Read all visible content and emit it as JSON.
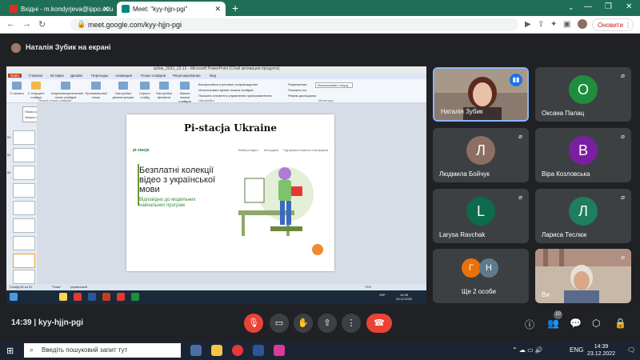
{
  "browser": {
    "tabs": [
      {
        "title": "Вхідні - m.kondyrjeva@ippo.edu"
      },
      {
        "title": "Meet: \"kyy-hjjn-pgi\""
      }
    ],
    "url": "meet.google.com/kyy-hjjn-pgi",
    "update_label": "Оновити"
  },
  "meet": {
    "presenting_label": "Наталія Зубик на екрані",
    "meeting_time": "14:39",
    "meeting_code": "kyy-hjjn-pgi",
    "people_count": "10",
    "participants": [
      {
        "name": "Наталія Зубик",
        "video": true
      },
      {
        "name": "Оксана Палац",
        "letter": "О",
        "color": "#1e8e3e"
      },
      {
        "name": "Людмила Бойчук",
        "letter": "Л",
        "color": "#8d6e63"
      },
      {
        "name": "Віра Козловська",
        "letter": "В",
        "color": "#7b1fa2"
      },
      {
        "name": "Larysa Ravchak",
        "letter": "L",
        "color": "#0b6b4b"
      },
      {
        "name": "Лариса Теслюк",
        "letter": "Л",
        "color": "#1e7e5e"
      },
      {
        "name": "Ще 2 особи",
        "letters": [
          "Г",
          "Н"
        ],
        "colors": [
          "#e8710a",
          "#5f7a8c"
        ]
      },
      {
        "name": "Ви",
        "video": true
      }
    ]
  },
  "powerpoint": {
    "title": "зубик_2022_23.12 - Microsoft PowerPoint (Сбой активации продукта)",
    "tabs": [
      "Файл",
      "Главная",
      "Вставка",
      "Дизайн",
      "Переходы",
      "Анимация",
      "Показ слайдов",
      "Рецензирование",
      "Вид"
    ],
    "ribbon_buttons": [
      "С начала",
      "С текущего слайда",
      "Широковещательный показ слайдов",
      "Произвольный показ",
      "Настройка демонстрации",
      "Скрыть слайд",
      "Настройка времени",
      "Запись показа слайдов"
    ],
    "checks": [
      "Воспроизвести речевое сопровождение",
      "Использовать время показа слайдов",
      "Показать элементы управления проигрывателем",
      "Разрешение:",
      "Использовать текущ...",
      "Показать на:",
      "Режим докладчика"
    ],
    "group_labels": [
      "Начать показ слайдов",
      "Настройка",
      "Мониторы"
    ],
    "tooltip_title": "Показ слайдов с текущего слайда (SHIFT+F5)",
    "tooltip_text": "Запуск показа слайдов с текущего слайда.",
    "status": {
      "slide": "Слайд 65 из 91",
      "theme": "\"Тема\"",
      "lang": "украинский",
      "zoom": "75%"
    },
    "slide": {
      "title": "Pi-stacja Ukraine",
      "brand": "pi-stacja",
      "nav": [
        "Вибери відео",
        "Методика",
        "Підтримка",
        "Новини платформи"
      ],
      "headline": "Безплатні колекції відео з української мови",
      "subtitle": "Відповідно до модельних навчальних програм"
    },
    "inner_clock": {
      "time": "14:39",
      "date": "23.12.2022",
      "lang": "УКР"
    }
  },
  "taskbar": {
    "search_placeholder": "Введіть пошуковий запит тут",
    "lang": "ENG",
    "time": "14:39",
    "date": "23.12.2022"
  }
}
